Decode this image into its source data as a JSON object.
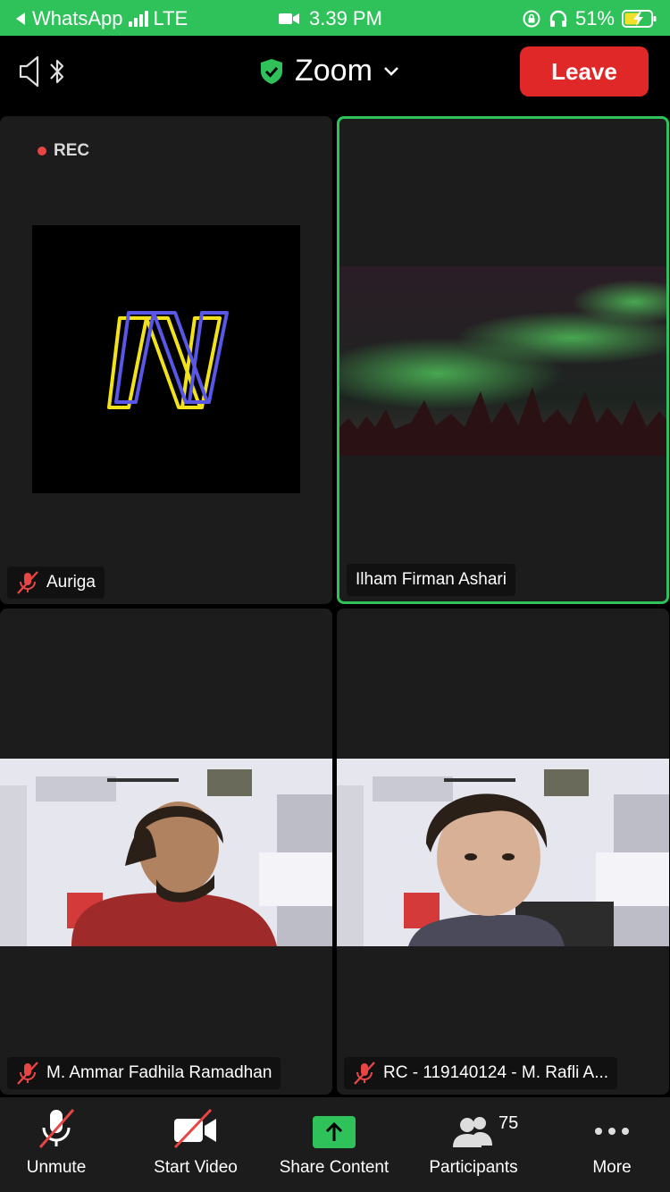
{
  "status_bar": {
    "back_app": "WhatsApp",
    "network": "LTE",
    "time": "3.39 PM",
    "battery": "51%"
  },
  "header": {
    "title": "Zoom",
    "leave_label": "Leave"
  },
  "tiles": {
    "rec_label": "REC",
    "auriga": "Auriga",
    "ilham": "Ilham Firman Ashari",
    "ammar": "M. Ammar Fadhila Ramadhan",
    "rafli": "RC - 119140124 - M. Rafli A..."
  },
  "toolbar": {
    "unmute": "Unmute",
    "start_video": "Start Video",
    "share_content": "Share Content",
    "participants": "Participants",
    "participants_count": "75",
    "more": "More"
  },
  "colors": {
    "accent_green": "#2fc25b",
    "leave_red": "#e02828",
    "mute_red": "#e84545"
  }
}
